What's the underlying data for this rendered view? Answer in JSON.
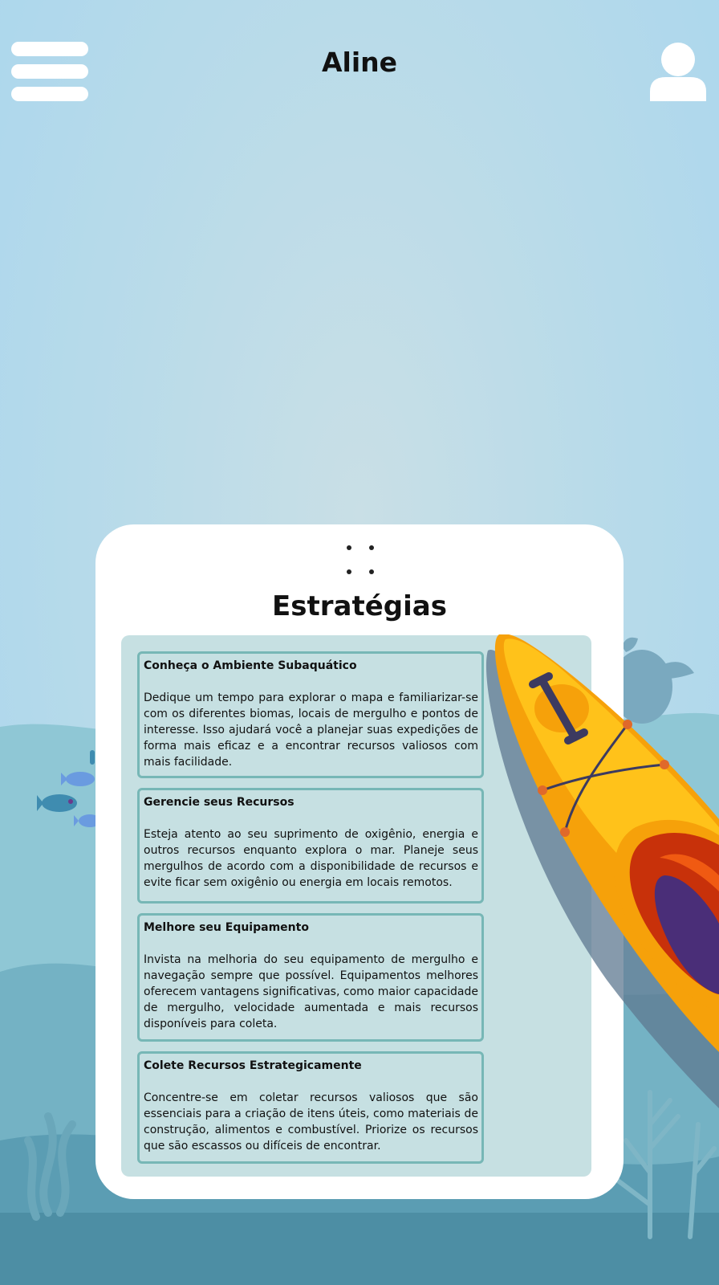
{
  "header": {
    "title": "Aline",
    "menu_icon": "hamburger-menu-icon",
    "profile_icon": "user-profile-icon"
  },
  "colors": {
    "sky_top": "#a9d6ee",
    "sea_light": "#86c4d2",
    "sea_dark": "#4f8fa6",
    "card_bg": "#ffffff",
    "panel_bg": "#c6e0e2",
    "tip_border": "#77b7b6",
    "kayak_yellow": "#ffc21a",
    "kayak_orange": "#f6a10a"
  },
  "strategies": {
    "title": "Estratégias",
    "items": [
      {
        "heading": "Conheça o Ambiente Subaquático",
        "body": "Dedique um tempo para explorar o mapa e familiarizar-se com os diferentes biomas, locais de mergulho e pontos de interesse. Isso ajudará você a planejar suas expedições de forma mais eficaz e a encontrar recursos valiosos com mais facilidade."
      },
      {
        "heading": "Gerencie seus Recursos",
        "body": "Esteja atento ao seu suprimento de oxigênio, energia e outros recursos enquanto explora o mar. Planeje seus mergulhos de acordo com a disponibilidade de recursos e evite ficar sem oxigênio ou energia em locais remotos."
      },
      {
        "heading": "Melhore seu Equipamento",
        "body": "Invista na melhoria do seu equipamento de mergulho e navegação sempre que possível. Equipamentos melhores oferecem vantagens significativas, como maior capacidade de mergulho, velocidade aumentada e mais recursos disponíveis para coleta."
      },
      {
        "heading": "Colete Recursos Estrategicamente",
        "body": "Concentre-se em coletar recursos valiosos que são essenciais para a criação de itens úteis, como materiais de construção, alimentos e combustível. Priorize os recursos que são escassos ou difíceis de encontrar."
      }
    ]
  }
}
